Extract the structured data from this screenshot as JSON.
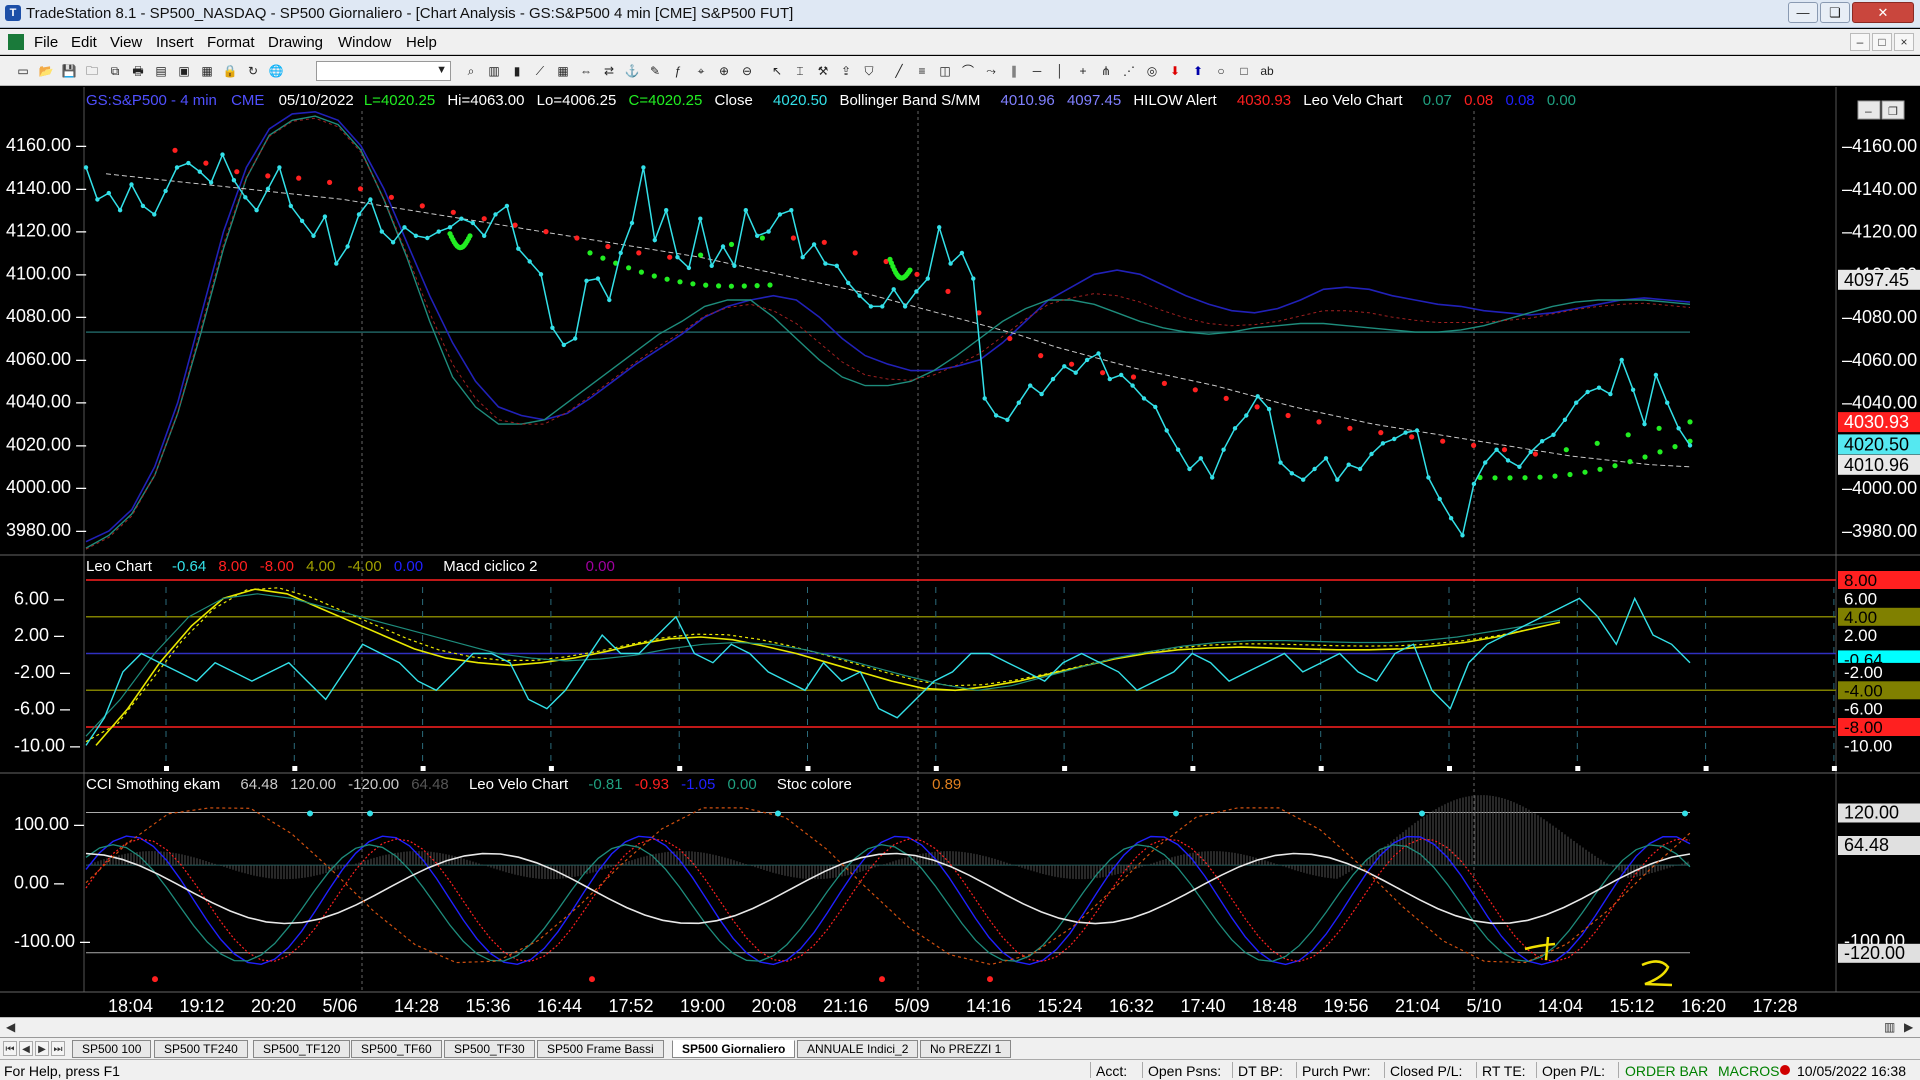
{
  "window": {
    "title": "TradeStation 8.1 - SP500_NASDAQ - SP500 Giornaliero - [Chart Analysis - GS:S&P500  4 min  [CME] S&P500 FUT]",
    "minimize": "—",
    "maximize": "❏",
    "close": "✕"
  },
  "menu": {
    "items": [
      "File",
      "Edit",
      "View",
      "Insert",
      "Format",
      "Drawing",
      "Window",
      "Help"
    ],
    "mdi": [
      "–",
      "□",
      "×"
    ]
  },
  "toolbar": {
    "icons": [
      "new-icon",
      "open-icon",
      "save-icon",
      "folder-icon",
      "save-all-icon",
      "print-icon",
      "print-preview-icon",
      "window-icon",
      "window-2-icon",
      "lock-icon",
      "refresh-icon",
      "globe-icon",
      "combo",
      "zoom-icon",
      "bar-chart-icon",
      "candle-icon",
      "line-chart-icon",
      "grid-icon",
      "scroll-icon",
      "sync-icon",
      "link-icon",
      "format-icon",
      "indicator-icon",
      "analysis-icon",
      "zoom-in-icon",
      "zoom-out-icon",
      "pointer-icon",
      "cursor-icon",
      "hammer-icon",
      "export-icon",
      "shield-icon",
      "trendline-icon",
      "fib-icon",
      "gann-icon",
      "arc-icon",
      "ray-icon",
      "channel-icon",
      "horizontal-line-icon",
      "vertical-line-icon",
      "cross-icon",
      "pitchfork-icon",
      "speed-line-icon",
      "cycle-icon",
      "arrow-down-icon",
      "arrow-up-icon",
      "ellipse-icon",
      "rectangle-icon",
      "text-tool-icon"
    ]
  },
  "symbol_bar": {
    "symbol": "GS:S&P500 - 4 min",
    "exchange": "CME",
    "date": "05/10/2022",
    "low": "L=4020.25",
    "high": "Hi=4063.00",
    "lo": "Lo=4006.25",
    "close": "C=4020.25",
    "close_label": "Close",
    "close_value": "4020.50",
    "bollinger_label": "Bollinger Band S/MM",
    "bollinger_values": [
      "4010.96",
      "4097.45"
    ],
    "hilow_label": "HILOW Alert",
    "hilow_value": "4030.93",
    "leo_label": "Leo Velo Chart",
    "leo_values": [
      "0.07",
      "0.08",
      "0.08",
      "0.00"
    ]
  },
  "colors": {
    "price": "#33e0e8",
    "bollinger": "#2121b8",
    "red_ma": "#ff2020",
    "green_ma": "#22ee22",
    "white_ma": "#c8c8c8",
    "yellow": "#e8e800",
    "olive": "#808000",
    "grid": "#1f6060"
  },
  "price_pane": {
    "ticks": [
      "4160.00",
      "4140.00",
      "4120.00",
      "4100.00",
      "4080.00",
      "4060.00",
      "4040.00",
      "4020.00",
      "4000.00",
      "3980.00"
    ],
    "flags": [
      {
        "text": "4097.45",
        "bg": "#e8e8e8",
        "fg": "#000"
      },
      {
        "text": "4030.93",
        "bg": "#ff2020",
        "fg": "#fff"
      },
      {
        "text": "4020.50",
        "bg": "#55e8f0",
        "fg": "#000"
      },
      {
        "text": "4010.96",
        "bg": "#e8e8e8",
        "fg": "#000"
      }
    ]
  },
  "macd_pane": {
    "label": "Leo Chart",
    "values": [
      "-0.64",
      "8.00",
      "-8.00",
      "4.00",
      "-4.00",
      "0.00"
    ],
    "label2": "Macd ciclico 2",
    "value2": "0.00",
    "ticks": [
      "6.00",
      "2.00",
      "-2.00",
      "-6.00",
      "-10.00"
    ],
    "flags": [
      {
        "text": "8.00",
        "bg": "#ff2020",
        "fg": "#000"
      },
      {
        "text": "6.00",
        "bg": "#000",
        "fg": "#fff"
      },
      {
        "text": "4.00",
        "bg": "#808000",
        "fg": "#000"
      },
      {
        "text": "2.00",
        "bg": "#000",
        "fg": "#fff"
      },
      {
        "text": "-0.64",
        "bg": "#00ffff",
        "fg": "#000"
      },
      {
        "text": "-2.00",
        "bg": "#000",
        "fg": "#fff"
      },
      {
        "text": "-4.00",
        "bg": "#808000",
        "fg": "#000"
      },
      {
        "text": "-6.00",
        "bg": "#000",
        "fg": "#fff"
      },
      {
        "text": "-8.00",
        "bg": "#ff2020",
        "fg": "#000"
      },
      {
        "text": "-10.00",
        "bg": "#000",
        "fg": "#fff"
      }
    ]
  },
  "cci_pane": {
    "label": "CCI Smothing ekam",
    "values": [
      "64.48",
      "120.00",
      "-120.00",
      "64.48"
    ],
    "label2": "Leo Velo Chart",
    "values2": [
      "-0.81",
      "-0.93",
      "-1.05",
      "0.00"
    ],
    "label3": "Stoc colore",
    "value3": "0.89",
    "ticks": [
      "100.00",
      "0.00",
      "-100.00"
    ],
    "flags": [
      {
        "text": "120.00",
        "bg": "#e0e0e0",
        "fg": "#000"
      },
      {
        "text": "64.48",
        "bg": "#e0e0e0",
        "fg": "#000"
      },
      {
        "text": "-100.00",
        "bg": "#000",
        "fg": "#fff"
      },
      {
        "text": "-120.00",
        "bg": "#e0e0e0",
        "fg": "#000"
      }
    ],
    "annotations": [
      "1",
      "2"
    ]
  },
  "time_axis": [
    "18:04",
    "19:12",
    "20:20",
    "5/06",
    "14:28",
    "15:36",
    "16:44",
    "17:52",
    "19:00",
    "20:08",
    "21:16",
    "5/09",
    "14:16",
    "15:24",
    "16:32",
    "17:40",
    "18:48",
    "19:56",
    "21:04",
    "5/10",
    "14:04",
    "15:12",
    "16:20",
    "17:28"
  ],
  "tabs": [
    "SP500 100",
    "SP500 TF240",
    "SP500_TF120",
    "SP500_TF60",
    "SP500_TF30",
    "SP500 Frame Bassi",
    "SP500 Giornaliero",
    "ANNUALE Indici_2",
    "No PREZZI 1"
  ],
  "active_tab": "SP500 Giornaliero",
  "status": {
    "help": "For Help, press F1",
    "fields": [
      "Acct:",
      "Open Psns:",
      "DT BP:",
      "Purch Pwr:",
      "Closed P/L:",
      "RT TE:",
      "Open P/L:"
    ],
    "order_bar": "ORDER BAR",
    "macros": "MACROS",
    "datetime": "10/05/2022 16:38"
  },
  "chart_data": {
    "type": "line",
    "price": [
      4150,
      4135,
      4138,
      4130,
      4142,
      4132,
      4128,
      4139,
      4150,
      4152,
      4148,
      4143,
      4156,
      4144,
      4136,
      4130,
      4140,
      4150,
      4132,
      4125,
      4118,
      4127,
      4105,
      4113,
      4128,
      4135,
      4120,
      4115,
      4122,
      4118,
      4117,
      4120,
      4122,
      4126,
      4124,
      4118,
      4128,
      4132,
      4112,
      4106,
      4100,
      4075,
      4067,
      4070,
      4097,
      4098,
      4088,
      4110,
      4124,
      4150,
      4116,
      4130,
      4108,
      4103,
      4126,
      4104,
      4113,
      4104,
      4130,
      4118,
      4120,
      4128,
      4130,
      4108,
      4114,
      4105,
      4104,
      4096,
      4090,
      4085,
      4085,
      4093,
      4085,
      4092,
      4098,
      4122,
      4105,
      4110,
      4098,
      4042,
      4034,
      4032,
      4040,
      4048,
      4044,
      4051,
      4057,
      4054,
      4060,
      4063,
      4051,
      4053,
      4048,
      4042,
      4038,
      4027,
      4018,
      4009,
      4014,
      4005,
      4018,
      4028,
      4034,
      4043,
      4037,
      4012,
      4007,
      4004,
      4009,
      4014,
      4004,
      4011,
      4009,
      4016,
      4021,
      4023,
      4026,
      4027,
      4005,
      3995,
      3986,
      3978,
      4002,
      4012,
      4018,
      4013,
      4010,
      4017,
      4022,
      4025,
      4032,
      4040,
      4045,
      4047,
      4044,
      4060,
      4046,
      4030,
      4053,
      4040,
      4028,
      4020
    ],
    "bollinger_upper": [
      3975,
      3980,
      3990,
      4010,
      4040,
      4080,
      4120,
      4150,
      4168,
      4175,
      4176,
      4172,
      4160,
      4140,
      4115,
      4090,
      4068,
      4050,
      4038,
      4034,
      4032,
      4035,
      4042,
      4050,
      4058,
      4065,
      4072,
      4080,
      4085,
      4088,
      4090,
      4088,
      4080,
      4070,
      4062,
      4058,
      4055,
      4055,
      4057,
      4060,
      4068,
      4078,
      4088,
      4094,
      4100,
      4102,
      4100,
      4095,
      4090,
      4086,
      4083,
      4082,
      4084,
      4088,
      4093,
      4094,
      4093,
      4090,
      4088,
      4086,
      4085,
      4083,
      4082,
      4081,
      4082,
      4084,
      4086,
      4088,
      4089,
      4088,
      4087
    ],
    "bollinger_lower": [
      3972,
      3978,
      3988,
      4006,
      4035,
      4072,
      4112,
      4145,
      4165,
      4172,
      4174,
      4170,
      4158,
      4135,
      4108,
      4078,
      4052,
      4038,
      4030,
      4030,
      4032,
      4040,
      4048,
      4056,
      4064,
      4072,
      4078,
      4085,
      4088,
      4088,
      4080,
      4070,
      4060,
      4052,
      4048,
      4048,
      4050,
      4055,
      4062,
      4070,
      4078,
      4084,
      4088,
      4088,
      4086,
      4082,
      4078,
      4075,
      4073,
      4072,
      4073,
      4075,
      4076,
      4077,
      4077,
      4076,
      4075,
      4074,
      4073,
      4073,
      4074,
      4076,
      4079,
      4082,
      4085,
      4087,
      4088,
      4088,
      4088,
      4087,
      4086
    ],
    "red_ma": [
      4158,
      4152,
      4148,
      4146,
      4145,
      4143,
      4140,
      4136,
      4132,
      4129,
      4126,
      4123,
      4120,
      4117,
      4113,
      4110,
      4108,
      4109,
      4114,
      4117,
      4117,
      4115,
      4110,
      4106,
      4100,
      4092,
      4082,
      4070,
      4062,
      4058,
      4054,
      4052,
      4049,
      4046,
      4042,
      4038,
      4034,
      4031,
      4028,
      4026,
      4024,
      4022,
      4020,
      4018,
      4016,
      4018,
      4021,
      4025,
      4028,
      4031
    ],
    "white_ma": [
      4147,
      4145,
      4143,
      4141,
      4139,
      4137,
      4135,
      4132,
      4129,
      4126,
      4123,
      4120,
      4117,
      4114,
      4111,
      4108,
      4104,
      4100,
      4096,
      4092,
      4087,
      4082,
      4077,
      4072,
      4066,
      4061,
      4056,
      4052,
      4048,
      4043,
      4038,
      4034,
      4030,
      4027,
      4024,
      4021,
      4018,
      4015,
      4013,
      4011,
      4010
    ],
    "leo_macd": [
      -10,
      -7,
      -2,
      0,
      -1,
      -2,
      -3,
      -1,
      -2,
      -3,
      -2,
      -1,
      -3,
      -5,
      -2,
      1,
      0,
      -1,
      -3,
      -4,
      -2,
      0,
      0,
      -1,
      -5,
      -6,
      -4,
      -1,
      2,
      0,
      0,
      2,
      4,
      0,
      -1,
      1,
      0,
      -2,
      -3,
      -4,
      -1,
      -3,
      -2,
      -6,
      -7,
      -5,
      -3,
      -2,
      0,
      0,
      -1,
      -2,
      -3,
      -1,
      0,
      -1,
      -2,
      -4,
      -3,
      -2,
      0,
      -1,
      -3,
      -2,
      -1,
      0,
      -2,
      -1,
      0,
      -2,
      -3,
      0,
      1,
      -4,
      -6,
      -1,
      1,
      2,
      3,
      4,
      5,
      6,
      4,
      1,
      6,
      2,
      1,
      -1
    ]
  }
}
